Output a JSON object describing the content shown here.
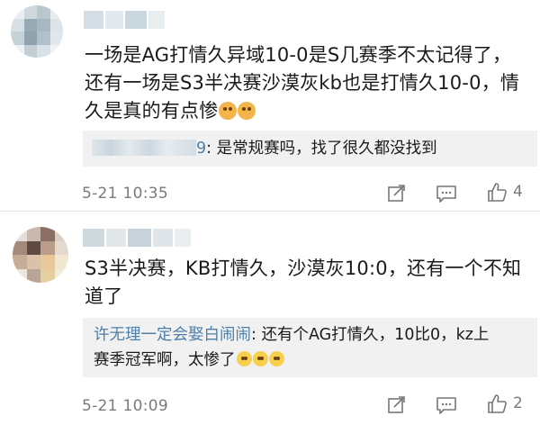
{
  "comments": [
    {
      "text_line1": "一场是AG打情久异域10-0是S几赛季不太记得了，",
      "text_line2": "还有一场是S3半决赛沙漠灰kb也是打情久10-0，情",
      "text_line3": "久是真的有点惨",
      "emojis": [
        "dog-icon",
        "dog-icon"
      ],
      "reply": {
        "replier_suffix": "9",
        "text": ": 是常规赛吗，找了很久都没找到"
      },
      "date": "5-21 10:35",
      "likes": "4"
    },
    {
      "text_line1": "S3半决赛，KB打情久，沙漠灰10:0，还有一个不知",
      "text_line2": "道了",
      "reply": {
        "replier": "许无理一定会娶白闹闹",
        "text_line1": ": 还有个AG打情久，10比0，kz上",
        "text_line2": "赛季冠军啊，太惨了"
      },
      "emojis": [
        "laugh-cry-icon",
        "laugh-cry-icon",
        "laugh-cry-icon"
      ],
      "date": "5-21 10:09",
      "likes": "2"
    }
  ],
  "icons": {
    "repost": "share-edit-icon",
    "comment": "comment-icon",
    "like": "thumbs-up-icon"
  }
}
